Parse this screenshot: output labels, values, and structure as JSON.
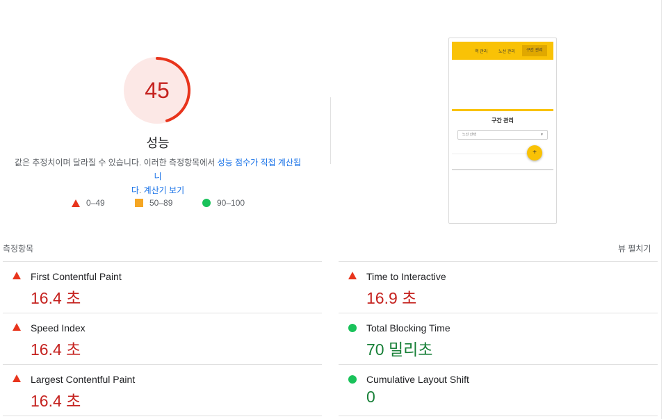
{
  "performance": {
    "score": "45",
    "score_fraction": 0.45,
    "title": "성능",
    "description_prefix": "값은 추정치이며 달라질 수 있습니다. 이러한 측정항목에서 ",
    "description_link1": "성능 점수가 직접 계산됩니",
    "description_link1b": "다",
    "description_mid": ". ",
    "description_link2": "계산기 보기",
    "colors": {
      "fail": "#e8341c",
      "fail_text": "#c5221f",
      "average": "#f5a623",
      "pass": "#19c25a",
      "pass_text": "#188038",
      "gauge_bg": "#fce8e6"
    }
  },
  "legend": [
    {
      "icon": "triangle-fail-icon",
      "label": "0–49"
    },
    {
      "icon": "square-average-icon",
      "label": "50–89"
    },
    {
      "icon": "circle-pass-icon",
      "label": "90–100"
    }
  ],
  "screenshot": {
    "nav_items": [
      "역 관리",
      "노선 관리",
      "구간 관리"
    ],
    "heading": "구간 관리",
    "select_placeholder": "노선 선택",
    "fab_label": "+"
  },
  "metrics": {
    "title": "측정항목",
    "toggle_label": "뷰 펼치기",
    "items": [
      {
        "name": "First Contentful Paint",
        "value": "16.4 초",
        "status": "fail"
      },
      {
        "name": "Time to Interactive",
        "value": "16.9 초",
        "status": "fail"
      },
      {
        "name": "Speed Index",
        "value": "16.4 초",
        "status": "fail"
      },
      {
        "name": "Total Blocking Time",
        "value": "70 밀리초",
        "status": "pass"
      },
      {
        "name": "Largest Contentful Paint",
        "value": "16.4 초",
        "status": "fail"
      },
      {
        "name": "Cumulative Layout Shift",
        "value": "0",
        "status": "pass"
      }
    ]
  }
}
